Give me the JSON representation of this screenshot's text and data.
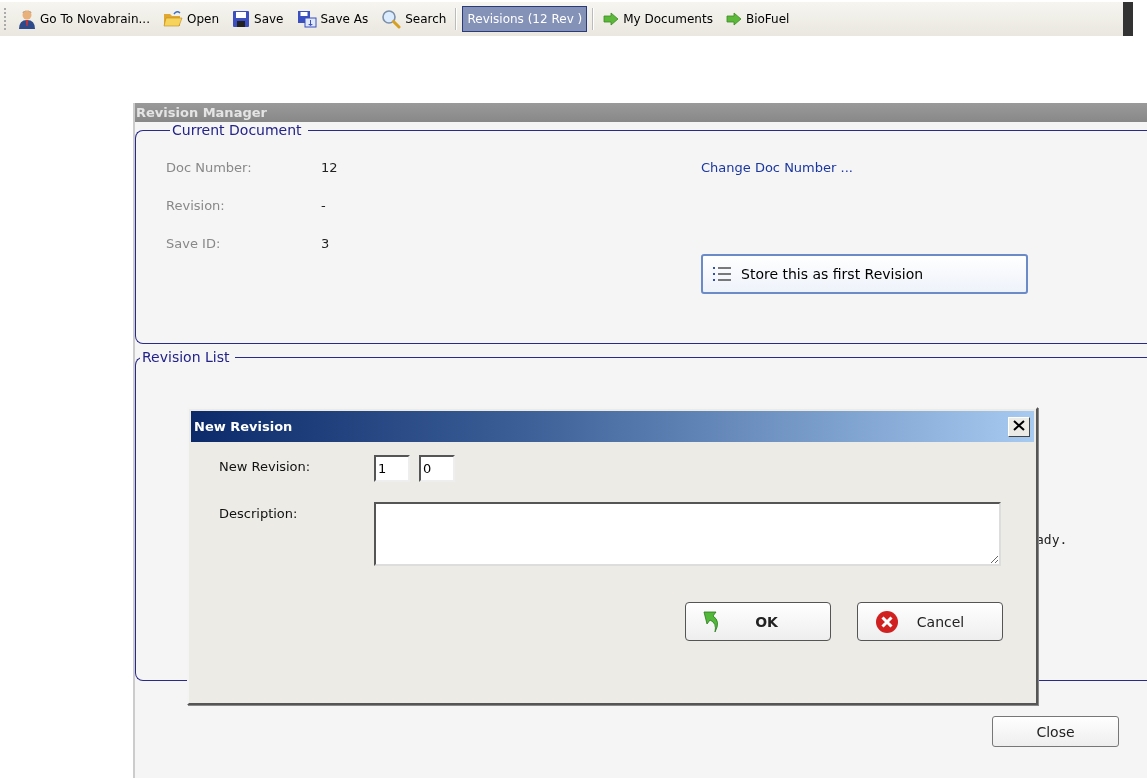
{
  "toolbar": {
    "items": [
      {
        "kind": "button",
        "label": "Go To Novabrain...",
        "selected": false
      },
      {
        "kind": "button",
        "label": "Open",
        "selected": false
      },
      {
        "kind": "button",
        "label": "Save",
        "selected": false
      },
      {
        "kind": "button",
        "label": "Save As",
        "selected": false
      },
      {
        "kind": "button",
        "label": "Search",
        "selected": false
      },
      {
        "kind": "separator"
      },
      {
        "kind": "button",
        "label": "Revisions (12 Rev )",
        "selected": true
      },
      {
        "kind": "separator"
      },
      {
        "kind": "link",
        "label": "My Documents",
        "selected": false
      },
      {
        "kind": "link",
        "label": "BioFuel",
        "selected": false
      }
    ]
  },
  "revision_manager": {
    "title": "Revision Manager",
    "current_document": {
      "title": "Current Document",
      "fields": [
        {
          "label": "Doc Number:",
          "value": "12"
        },
        {
          "label": "Revision:",
          "value": "-"
        },
        {
          "label": "Save ID:",
          "value": "3"
        }
      ],
      "change_link": "Change Doc Number ...",
      "store_button": "Store this as first Revision"
    },
    "revision_list": {
      "title": "Revision List",
      "message": "ady."
    },
    "close_button": "Close"
  },
  "new_revision_dialog": {
    "title": "New Revision",
    "new_revision_label": "New Revision:",
    "major": "1",
    "minor": "0",
    "description_label": "Description:",
    "ok_button": "OK",
    "cancel_button": "Cancel"
  }
}
